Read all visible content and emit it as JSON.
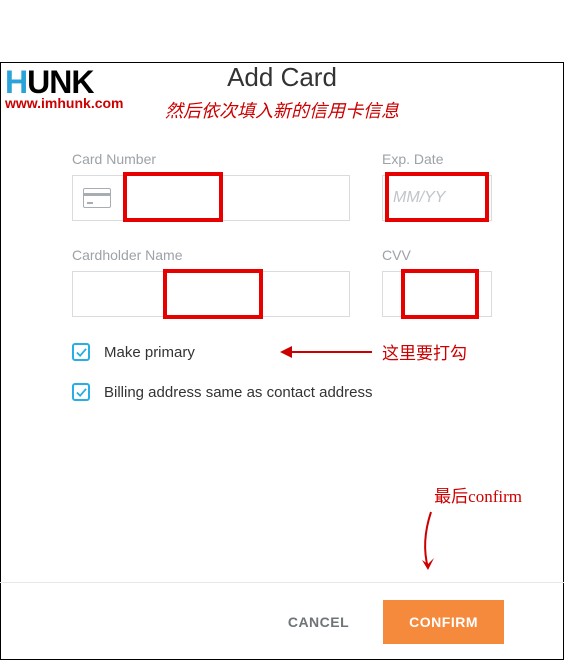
{
  "logo": {
    "prefix": "H",
    "suffix": "UNK",
    "url": "www.imhunk.com"
  },
  "title": "Add Card",
  "annotations": {
    "fill_info": "然后依次填入新的信用卡信息",
    "check_here": "这里要打勾",
    "confirm_last": "最后confirm"
  },
  "fields": {
    "card_number": {
      "label": "Card Number",
      "placeholder": ""
    },
    "exp_date": {
      "label": "Exp. Date",
      "placeholder": "MM/YY"
    },
    "cardholder": {
      "label": "Cardholder Name",
      "placeholder": ""
    },
    "cvv": {
      "label": "CVV",
      "placeholder": ""
    }
  },
  "checkboxes": {
    "make_primary": "Make primary",
    "billing_same": "Billing address same as contact address"
  },
  "buttons": {
    "cancel": "CANCEL",
    "confirm": "CONFIRM"
  }
}
